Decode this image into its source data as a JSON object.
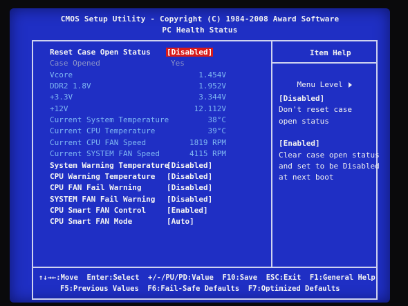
{
  "header": {
    "title": "CMOS Setup Utility - Copyright (C) 1984-2008 Award Software",
    "subtitle": "PC Health Status"
  },
  "items": [
    {
      "label": "Reset Case Open Status",
      "value": "[Disabled]",
      "style": "selected"
    },
    {
      "label": "Case Opened",
      "value": "Yes",
      "style": "disabled"
    },
    {
      "label": "Vcore",
      "value": "1.454V",
      "style": "info"
    },
    {
      "label": "DDR2 1.8V",
      "value": "1.952V",
      "style": "info"
    },
    {
      "label": "+3.3V",
      "value": "3.344V",
      "style": "info"
    },
    {
      "label": "+12V",
      "value": "12.112V",
      "style": "info"
    },
    {
      "label": "Current System Temperature",
      "value": "38°C",
      "style": "info"
    },
    {
      "label": "Current CPU Temperature",
      "value": "39°C",
      "style": "info"
    },
    {
      "label": "Current CPU FAN Speed",
      "value": "1819 RPM",
      "style": "info"
    },
    {
      "label": "Current SYSTEM FAN Speed",
      "value": "4115 RPM",
      "style": "info"
    },
    {
      "label": "System Warning Temperature",
      "value": "[Disabled]",
      "style": "option"
    },
    {
      "label": "CPU Warning Temperature",
      "value": "[Disabled]",
      "style": "option"
    },
    {
      "label": "CPU FAN Fail Warning",
      "value": "[Disabled]",
      "style": "option"
    },
    {
      "label": "SYSTEM FAN Fail Warning",
      "value": "[Disabled]",
      "style": "option"
    },
    {
      "label": "CPU Smart FAN Control",
      "value": "[Enabled]",
      "style": "option"
    },
    {
      "label": "CPU Smart FAN Mode",
      "value": "[Auto]",
      "style": "option"
    }
  ],
  "help": {
    "title": "Item Help",
    "menu_level": "Menu Level",
    "lines": [
      {
        "text": "[Disabled]",
        "bold": true
      },
      {
        "text": "Don't reset case",
        "bold": false
      },
      {
        "text": "open status",
        "bold": false
      },
      {
        "text": "",
        "bold": false
      },
      {
        "text": "[Enabled]",
        "bold": true
      },
      {
        "text": "Clear case open status",
        "bold": false
      },
      {
        "text": "and set to be Disabled",
        "bold": false
      },
      {
        "text": "at next boot",
        "bold": false
      }
    ]
  },
  "footer": {
    "line1": "↑↓→←:Move  Enter:Select  +/-/PU/PD:Value  F10:Save  ESC:Exit  F1:General Help",
    "line2": "F5:Previous Values  F6:Fail-Safe Defaults  F7:Optimized Defaults"
  },
  "colors": {
    "background": "#1f2fc4",
    "option_text": "#f4f4f4",
    "info_text": "#7fb7f2",
    "disabled_text": "#8a93c8",
    "highlight": "#d91a1a",
    "border": "#cfd3f0"
  }
}
